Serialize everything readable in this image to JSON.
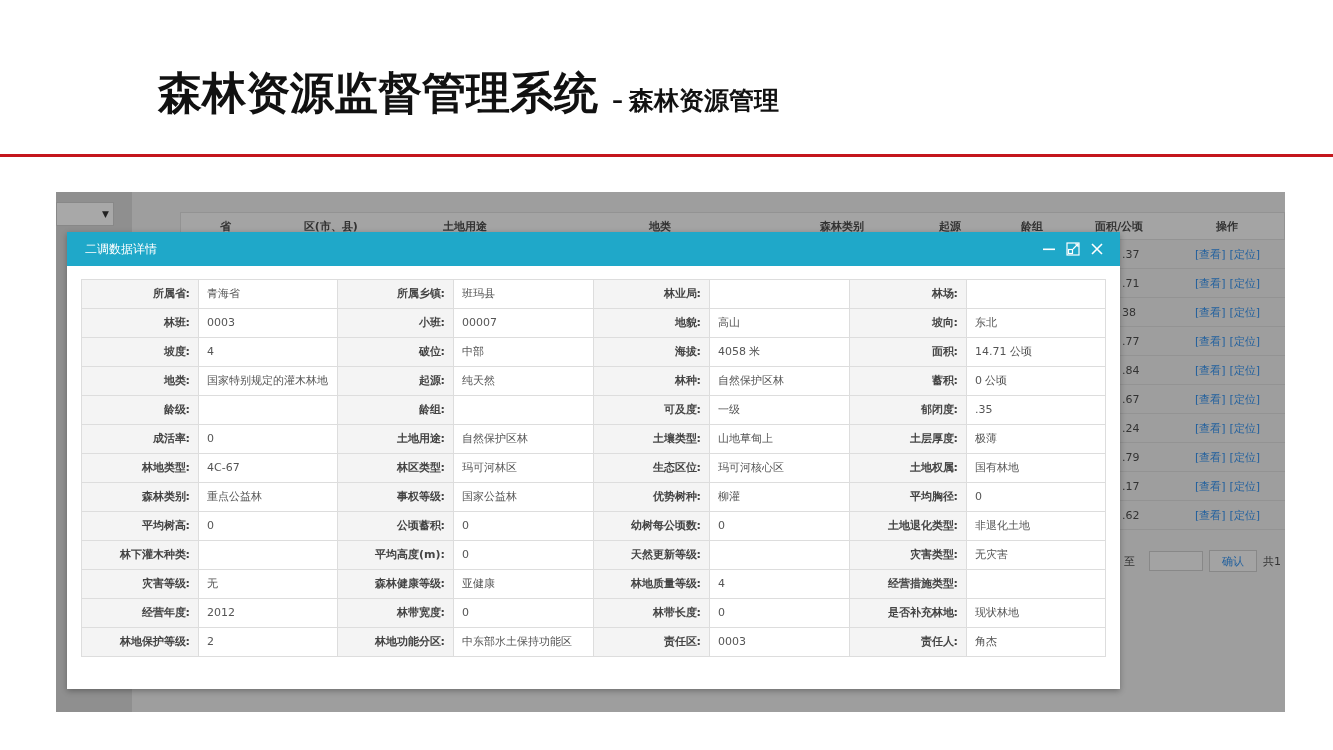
{
  "slide": {
    "title": "森林资源监督管理系统",
    "subtitle_dash": "–",
    "subtitle": "森林资源管理"
  },
  "background_app": {
    "dropdown_caret": "▼",
    "table": {
      "columns": [
        "省",
        "区(市、县)",
        "土地用途",
        "地类",
        "森林类别",
        "起源",
        "龄组",
        "面积/公顷",
        "操作"
      ],
      "rows": [
        {
          "area": ".37",
          "actions": [
            "[查看]",
            "[定位]"
          ]
        },
        {
          "area": ".71",
          "actions": [
            "[查看]",
            "[定位]"
          ]
        },
        {
          "area": "38",
          "actions": [
            "[查看]",
            "[定位]"
          ]
        },
        {
          "area": ".77",
          "actions": [
            "[查看]",
            "[定位]"
          ]
        },
        {
          "area": ".84",
          "actions": [
            "[查看]",
            "[定位]"
          ]
        },
        {
          "area": ".67",
          "actions": [
            "[查看]",
            "[定位]"
          ]
        },
        {
          "area": ".24",
          "actions": [
            "[查看]",
            "[定位]"
          ]
        },
        {
          "area": ".79",
          "actions": [
            "[查看]",
            "[定位]"
          ]
        },
        {
          "area": ".17",
          "actions": [
            "[查看]",
            "[定位]"
          ]
        },
        {
          "area": ".62",
          "actions": [
            "[查看]",
            "[定位]"
          ]
        }
      ]
    },
    "pagination": {
      "to_label": "至",
      "confirm": "确认",
      "total": "共1"
    }
  },
  "dialog": {
    "title": "二调数据详情",
    "rows": [
      [
        {
          "label": "所属省:",
          "value": "青海省"
        },
        {
          "label": "所属乡镇:",
          "value": "班玛县"
        },
        {
          "label": "林业局:"
        },
        {
          "label": "林场:"
        }
      ],
      [
        {
          "label": "林班:",
          "value": "0003"
        },
        {
          "label": "小班:",
          "value": "00007"
        },
        {
          "label": "地貌:",
          "value": "高山"
        },
        {
          "label": "坡向:",
          "value": "东北"
        }
      ],
      [
        {
          "label": "坡度:",
          "value": "4"
        },
        {
          "label": "破位:",
          "value": "中部"
        },
        {
          "label": "海拔:",
          "value": "4058 米"
        },
        {
          "label": "面积:",
          "value": "14.71 公顷"
        }
      ],
      [
        {
          "label": "地类:",
          "value": "国家特别规定的灌木林地"
        },
        {
          "label": "起源:",
          "value": "纯天然"
        },
        {
          "label": "林种:",
          "value": "自然保护区林"
        },
        {
          "label": "蓄积:",
          "value": "0 公顷"
        }
      ],
      [
        {
          "label": "龄级:"
        },
        {
          "label": "龄组:"
        },
        {
          "label": "可及度:",
          "value": "一级"
        },
        {
          "label": "郁闭度:",
          "value": ".35"
        }
      ],
      [
        {
          "label": "成活率:",
          "value": "0"
        },
        {
          "label": "土地用途:",
          "value": "自然保护区林"
        },
        {
          "label": "土壤类型:",
          "value": "山地草甸上"
        },
        {
          "label": "土层厚度:",
          "value": "极薄"
        }
      ],
      [
        {
          "label": "林地类型:",
          "value": "4C-67"
        },
        {
          "label": "林区类型:",
          "value": "玛可河林区"
        },
        {
          "label": "生态区位:",
          "value": "玛可河核心区"
        },
        {
          "label": "土地权属:",
          "value": "国有林地"
        }
      ],
      [
        {
          "label": "森林类别:",
          "value": "重点公益林"
        },
        {
          "label": "事权等级:",
          "value": "国家公益林"
        },
        {
          "label": "优势树种:",
          "value": "柳灌"
        },
        {
          "label": "平均胸径:",
          "value": "0"
        }
      ],
      [
        {
          "label": "平均树高:",
          "value": "0"
        },
        {
          "label": "公顷蓄积:",
          "value": "0"
        },
        {
          "label": "幼树每公顷数:",
          "value": "0"
        },
        {
          "label": "土地退化类型:",
          "value": "非退化土地"
        }
      ],
      [
        {
          "label": "林下灌木种类:"
        },
        {
          "label": "平均高度(m):",
          "value": "0"
        },
        {
          "label": "天然更新等级:"
        },
        {
          "label": "灾害类型:",
          "value": "无灾害"
        }
      ],
      [
        {
          "label": "灾害等级:",
          "value": "无"
        },
        {
          "label": "森林健康等级:",
          "value": "亚健康"
        },
        {
          "label": "林地质量等级:",
          "value": "4"
        },
        {
          "label": "经营措施类型:"
        }
      ],
      [
        {
          "label": "经营年度:",
          "value": "2012"
        },
        {
          "label": "林带宽度:",
          "value": "0"
        },
        {
          "label": "林带长度:",
          "value": "0"
        },
        {
          "label": "是否补充林地:",
          "value": "现状林地"
        }
      ],
      [
        {
          "label": "林地保护等级:",
          "value": "2"
        },
        {
          "label": "林地功能分区:",
          "value": "中东部水土保持功能区"
        },
        {
          "label": "责任区:",
          "value": "0003"
        },
        {
          "label": "责任人:",
          "value": "角杰"
        }
      ]
    ]
  }
}
